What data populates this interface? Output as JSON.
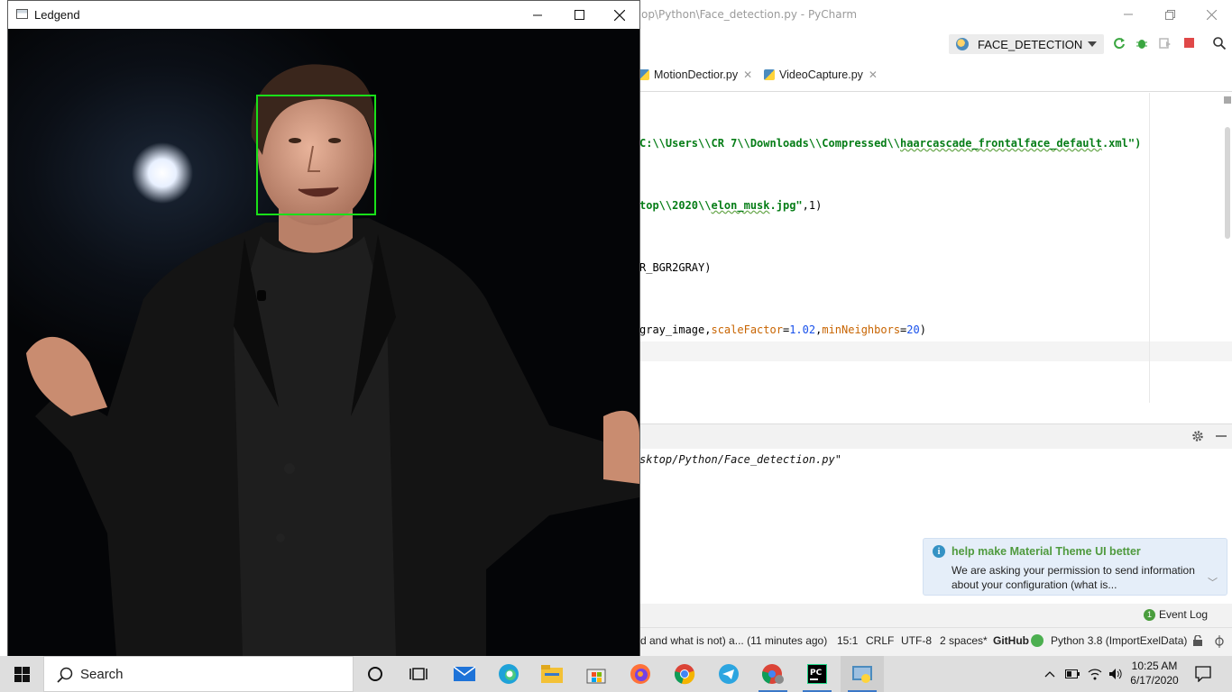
{
  "pycharm": {
    "title": "op\\Python\\Face_detection.py - PyCharm",
    "run_config": "FACE_DETECTION",
    "tabs": [
      {
        "label": "MotionDectior.py"
      },
      {
        "label": "VideoCapture.py"
      }
    ],
    "code": {
      "line1_str": "C:\\\\Users\\\\CR 7\\\\Downloads\\\\Compressed\\\\",
      "line1_squig": "haarcascade_frontalface_default",
      "line1_tail": ".xml\")",
      "line2_str_a": "top\\\\2020\\\\",
      "line2_squig": "elon_musk",
      "line2_str_b": ".jpg\"",
      "line2_tail": ",1)",
      "line3": "R_BGR2GRAY)",
      "line4_a": "gray_image,",
      "line4_kw1": "scaleFactor",
      "line4_eq1": "=",
      "line4_num1": "1.02",
      "line4_comma": ",",
      "line4_kw2": "minNeighbors",
      "line4_eq2": "=",
      "line4_num2": "20",
      "line4_tail": ")"
    },
    "console_text": "sktop/Python/Face_detection.py\"",
    "notification": {
      "title": "help make Material Theme UI better",
      "body": "We are asking your permission to send information about your configuration (what is..."
    },
    "event_log": {
      "count": "1",
      "label": "Event Log"
    },
    "status": {
      "message": "d and what is not) a... (11 minutes ago)",
      "position": "15:1",
      "line_sep": "CRLF",
      "encoding": "UTF-8",
      "indent": "2 spaces*",
      "github": "GitHub",
      "interpreter": "Python 3.8 (ImportExelData)"
    }
  },
  "cv_window": {
    "title": "Ledgend",
    "face_box_color": "#19e019"
  },
  "taskbar": {
    "search_label": "Search",
    "apps": [
      "cortana-icon",
      "task-view-icon",
      "mail-icon",
      "edge-icon",
      "file-explorer-icon",
      "store-icon",
      "firefox-icon",
      "chrome-icon",
      "telegram-icon",
      "chrome-profile-icon",
      "pycharm-icon",
      "python-icon"
    ],
    "clock": {
      "time": "10:25 AM",
      "date": "6/17/2020"
    }
  }
}
